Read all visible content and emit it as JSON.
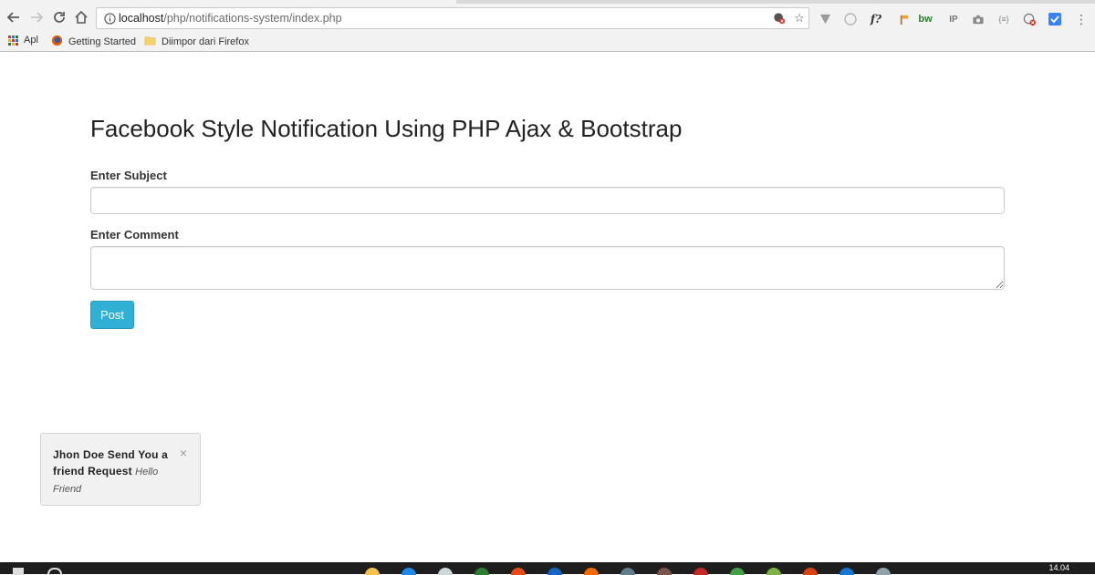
{
  "browser": {
    "url_host": "localhost",
    "url_path": "/php/notifications-system/index.php",
    "bookmarks": [
      {
        "label": "Apl",
        "icon": "apps-grid-icon"
      },
      {
        "label": "Getting Started",
        "icon": "firefox-icon"
      },
      {
        "label": "Diimpor dari Firefox",
        "icon": "folder-icon"
      }
    ],
    "extensions": [
      "vivaldi-icon",
      "circle-icon",
      "formula-icon",
      "flag-icon",
      "bw-icon",
      "ip-icon",
      "camera-icon",
      "json-icon",
      "blocked-icon",
      "checkmark-icon"
    ],
    "extension_labels": {
      "formula": "f?",
      "bw": "bw",
      "ip": "IP",
      "json": "{≡}"
    }
  },
  "page": {
    "title": "Facebook Style Notification Using PHP Ajax & Bootstrap",
    "subject_label": "Enter Subject",
    "subject_value": "",
    "comment_label": "Enter Comment",
    "comment_value": "",
    "post_button": "Post"
  },
  "notification": {
    "title": "Jhon Doe Send You a friend Request",
    "body": "Hello Friend",
    "close": "×"
  },
  "taskbar": {
    "clock": "14.04"
  },
  "colors": {
    "button": "#31b0d5",
    "chrome": "#f2f2f2",
    "taskbar": "#1e1e1e",
    "notification_bg": "#f1f1f1"
  }
}
